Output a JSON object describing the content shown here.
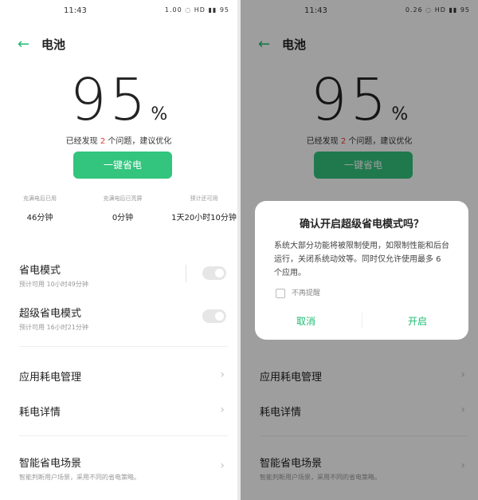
{
  "status": {
    "time": "11:43",
    "left_icons": "1.00 ◌ HD ▮▮ 95",
    "right_icons": "0.26 ◌ HD ▮▮ 95"
  },
  "header": {
    "back_icon": "arrow-left-icon",
    "title": "电池"
  },
  "battery": {
    "percent": "95",
    "percent_unit": "%",
    "issue_prefix": "已经发现",
    "issue_count": "2",
    "issue_suffix": "个问题，建议优化"
  },
  "optimize_button": "一键省电",
  "stats": [
    {
      "label": "充满电后已用",
      "value": "46分钟"
    },
    {
      "label": "充满电后已亮屏",
      "value": "0分钟"
    },
    {
      "label": "预计还可用",
      "value": "1天20小时10分钟"
    }
  ],
  "modes": [
    {
      "name": "省电模式",
      "sub": "预计可用 10小时49分钟"
    },
    {
      "name": "超级省电模式",
      "sub": "预计可用 16小时21分钟"
    }
  ],
  "menu": {
    "app_power": "应用耗电管理",
    "power_detail": "耗电详情",
    "smart_scene": "智能省电场景",
    "smart_scene_sub": "智能判断用户场景，采用不同的省电策略。"
  },
  "dialog": {
    "title": "确认开启超级省电模式吗？",
    "body": "系统大部分功能将被限制使用，如限制性能和后台运行，关闭系统动效等。同时仅允许使用最多 6 个应用。",
    "checkbox_label": "不再提醒",
    "cancel": "取消",
    "confirm": "开启"
  },
  "colors": {
    "accent": "#1ebc72",
    "button": "#33c47d",
    "highlight": "#e53935"
  }
}
